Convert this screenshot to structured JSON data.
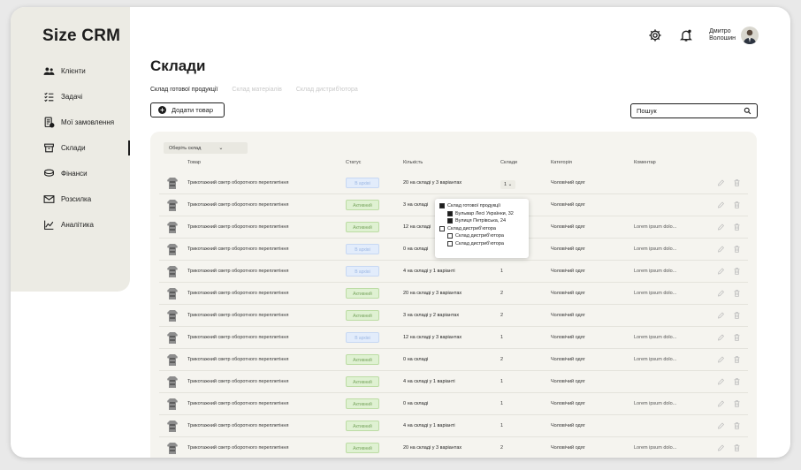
{
  "app": {
    "brand": "Size CRM"
  },
  "sidebar": {
    "items": [
      {
        "label": "Клієнти",
        "icon": "users-icon"
      },
      {
        "label": "Задачі",
        "icon": "checklist-icon"
      },
      {
        "label": "Мої замовлення",
        "icon": "orders-icon"
      },
      {
        "label": "Склади",
        "icon": "warehouse-icon",
        "active": true
      },
      {
        "label": "Фінанси",
        "icon": "coins-icon"
      },
      {
        "label": "Розсилка",
        "icon": "mail-icon"
      },
      {
        "label": "Аналітика",
        "icon": "analytics-icon"
      }
    ]
  },
  "topbar": {
    "user_name_line1": "Дмитро",
    "user_name_line2": "Волошин"
  },
  "page": {
    "title": "Склади",
    "tabs": [
      "Склад готової продукції",
      "Склад матеріалів",
      "Склад дистриб'ютора"
    ],
    "add_button": "Додати товар",
    "search_placeholder": "Пошук",
    "warehouse_select": "Оберіть склад"
  },
  "table": {
    "headers": [
      "Товар",
      "Статус",
      "Кількість",
      "Склади",
      "Категорія",
      "Коментар"
    ],
    "rows": [
      {
        "product": "Трикотажний светр оборотного переплетіння",
        "status": "В архіві",
        "status_type": "blue",
        "qty": "20 на складі у 3 варіантах",
        "wh": "1",
        "cat": "Чоловічий одяг",
        "comment": ""
      },
      {
        "product": "Трикотажний светр оборотного переплетіння",
        "status": "Активний",
        "status_type": "green",
        "qty": "3 на складі",
        "wh": "",
        "cat": "Чоловічий одяг",
        "comment": ""
      },
      {
        "product": "Трикотажний светр оборотного переплетіння",
        "status": "Активний",
        "status_type": "green",
        "qty": "12 на складі",
        "wh": "",
        "cat": "Чоловічий одяг",
        "comment": "Lorem ipsum dolo..."
      },
      {
        "product": "Трикотажний светр оборотного переплетіння",
        "status": "В архіві",
        "status_type": "blue",
        "qty": "0 на складі",
        "wh": "1",
        "cat": "Чоловічий одяг",
        "comment": "Lorem ipsum dolo..."
      },
      {
        "product": "Трикотажний светр оборотного переплетіння",
        "status": "В архіві",
        "status_type": "blue",
        "qty": "4 на складі у 1 варіанті",
        "wh": "1",
        "cat": "Чоловічий одяг",
        "comment": "Lorem ipsum dolo..."
      },
      {
        "product": "Трикотажний светр оборотного переплетіння",
        "status": "Активний",
        "status_type": "green",
        "qty": "20 на складі у 3 варіантах",
        "wh": "2",
        "cat": "Чоловічий одяг",
        "comment": "Lorem ipsum dolo..."
      },
      {
        "product": "Трикотажний светр оборотного переплетіння",
        "status": "Активний",
        "status_type": "green",
        "qty": "3 на складі у 2 варіантах",
        "wh": "2",
        "cat": "Чоловічий одяг",
        "comment": ""
      },
      {
        "product": "Трикотажний светр оборотного переплетіння",
        "status": "В архіві",
        "status_type": "blue",
        "qty": "12 на складі у 3 варіантах",
        "wh": "1",
        "cat": "Чоловічий одяг",
        "comment": "Lorem ipsum dolo..."
      },
      {
        "product": "Трикотажний светр оборотного переплетіння",
        "status": "Активний",
        "status_type": "green",
        "qty": "0 на складі",
        "wh": "2",
        "cat": "Чоловічий одяг",
        "comment": "Lorem ipsum dolo..."
      },
      {
        "product": "Трикотажний светр оборотного переплетіння",
        "status": "Активний",
        "status_type": "green",
        "qty": "4 на складі у 1 варіанті",
        "wh": "1",
        "cat": "Чоловічий одяг",
        "comment": ""
      },
      {
        "product": "Трикотажний светр оборотного переплетіння",
        "status": "Активний",
        "status_type": "green",
        "qty": "0 на складі",
        "wh": "1",
        "cat": "Чоловічий одяг",
        "comment": "Lorem ipsum dolo..."
      },
      {
        "product": "Трикотажний светр оборотного переплетіння",
        "status": "Активний",
        "status_type": "green",
        "qty": "4 на складі у 1 варіанті",
        "wh": "1",
        "cat": "Чоловічий одяг",
        "comment": ""
      },
      {
        "product": "Трикотажний светр оборотного переплетіння",
        "status": "Активний",
        "status_type": "green",
        "qty": "20 на складі у 3 варіантах",
        "wh": "2",
        "cat": "Чоловічий одяг",
        "comment": "Lorem ipsum dolo..."
      }
    ]
  },
  "popover": {
    "items": [
      {
        "label": "Склад готової продукції",
        "checked": true,
        "sub": false
      },
      {
        "label": "Бульвар Лесі Українки, 32",
        "checked": true,
        "sub": true
      },
      {
        "label": "Вулиця Петрівська, 24",
        "checked": true,
        "sub": true
      },
      {
        "label": "Склад дистриб'ютора",
        "checked": false,
        "sub": false
      },
      {
        "label": "Склад дистриб'ютора",
        "checked": false,
        "sub": true
      },
      {
        "label": "Склад дистриб'ютора",
        "checked": false,
        "sub": true
      }
    ]
  },
  "colors": {
    "sidebar_bg": "#ecebe4",
    "panel_bg": "#f5f4ef",
    "active_green": "#dff1d2",
    "archive_blue": "#e2ecfb"
  }
}
